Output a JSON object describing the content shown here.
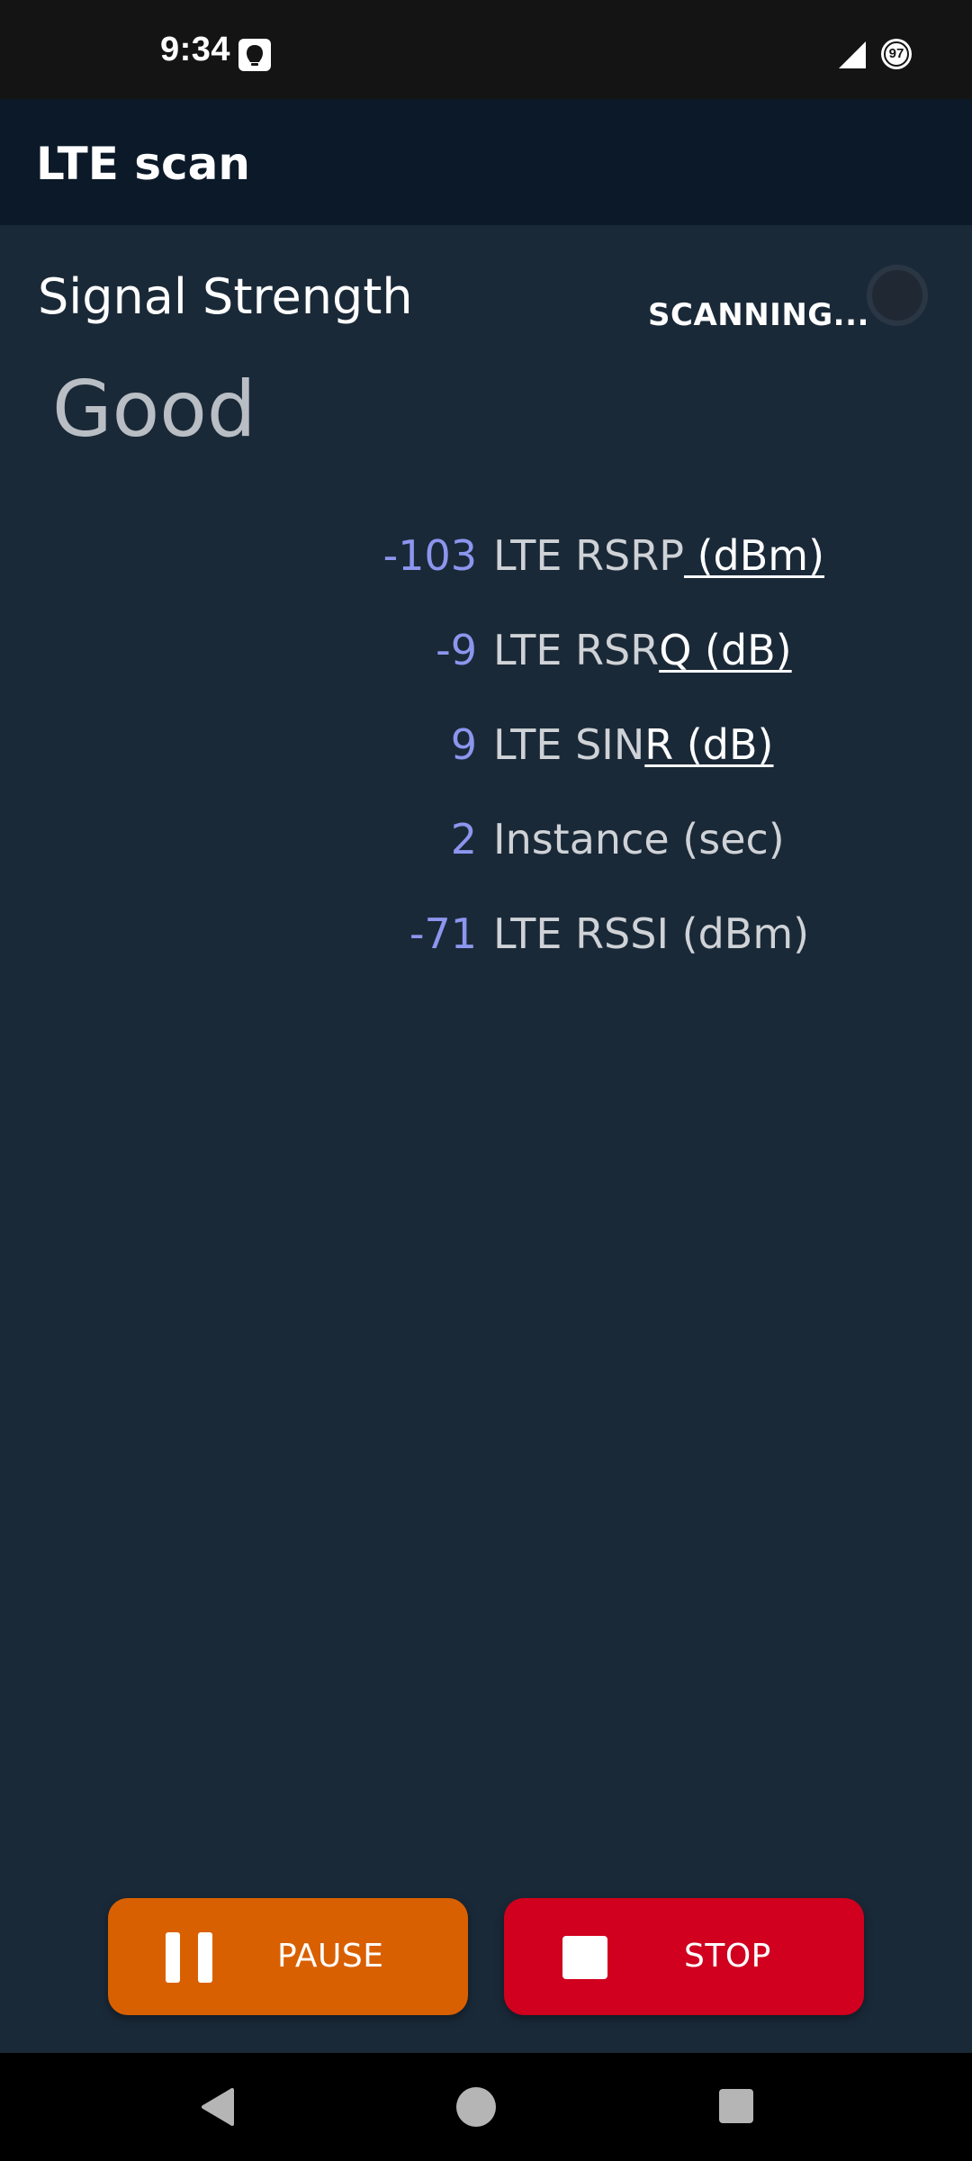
{
  "status_bar": {
    "time": "9:34",
    "notification_icon": "notification-square-icon",
    "signal_icon": "cell-signal-icon",
    "battery_level": "97"
  },
  "app_bar": {
    "title": "LTE scan"
  },
  "signal": {
    "label": "Signal Strength",
    "value": "Good",
    "scan_status": "SCANNING..."
  },
  "metrics": [
    {
      "value": "-103",
      "label_plain": "LTE RSRP",
      "label_underlined": " (dBm)"
    },
    {
      "value": "-9",
      "label_plain": "LTE RSR",
      "label_underlined": "Q (dB)"
    },
    {
      "value": "9",
      "label_plain": "LTE SIN",
      "label_underlined": "R (dB)"
    },
    {
      "value": "2",
      "label_plain": "Instance (sec)",
      "label_underlined": ""
    },
    {
      "value": "-71",
      "label_plain": "LTE RSSI (dBm)",
      "label_underlined": ""
    }
  ],
  "buttons": {
    "pause_label": "PAUSE",
    "stop_label": "STOP"
  },
  "colors": {
    "background": "#1a2938",
    "app_bar": "#0b1928",
    "metric_value": "#8c96ee",
    "pause_button": "#d96000",
    "stop_button": "#d0001e"
  },
  "nav_bar": {
    "back_icon": "back-triangle-icon",
    "home_icon": "home-circle-icon",
    "recents_icon": "recents-square-icon"
  }
}
